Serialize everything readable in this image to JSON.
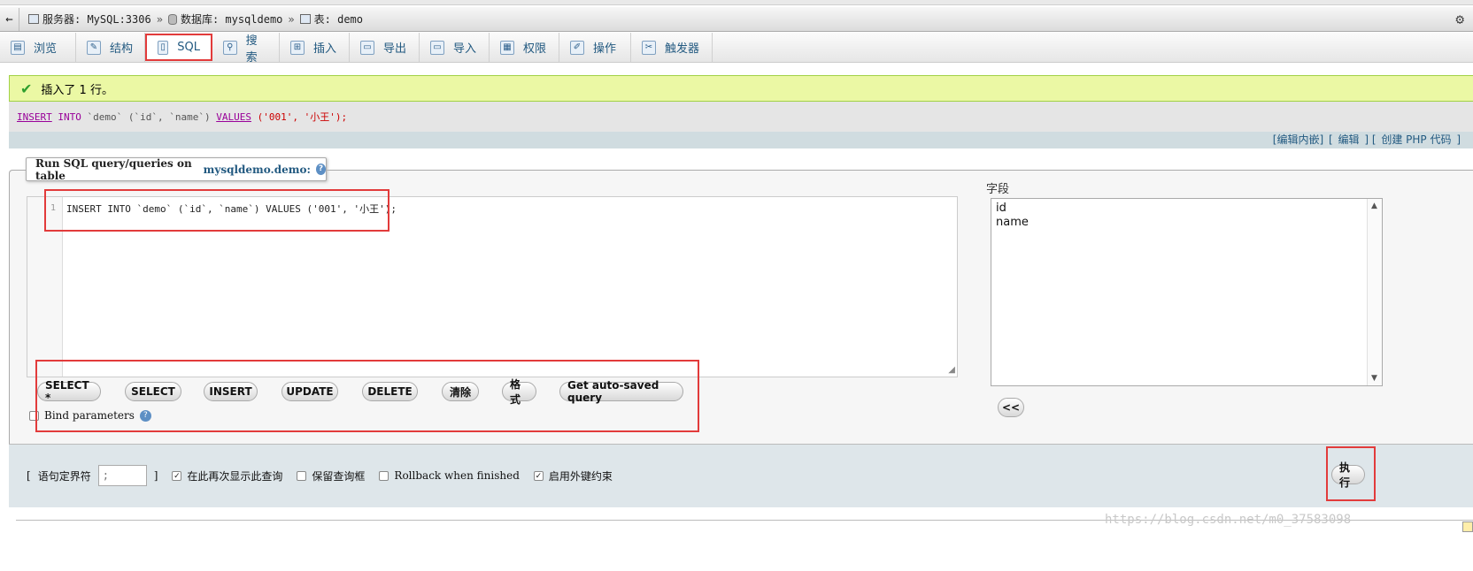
{
  "breadcrumb": {
    "back_icon": "←",
    "server": "服务器: MySQL:3306",
    "database": "数据库: mysqldemo",
    "table": "表: demo",
    "sep": "»"
  },
  "tabs": [
    {
      "label": "浏览",
      "icon": "browse-icon",
      "glyph": "▤"
    },
    {
      "label": "结构",
      "icon": "structure-icon",
      "glyph": "✎"
    },
    {
      "label": "SQL",
      "icon": "sql-icon",
      "glyph": "▯"
    },
    {
      "label": "搜索",
      "icon": "search-icon",
      "glyph": "⚲"
    },
    {
      "label": "插入",
      "icon": "insert-icon",
      "glyph": "⊞"
    },
    {
      "label": "导出",
      "icon": "export-icon",
      "glyph": "▭"
    },
    {
      "label": "导入",
      "icon": "import-icon",
      "glyph": "▭"
    },
    {
      "label": "权限",
      "icon": "privileges-icon",
      "glyph": "▦"
    },
    {
      "label": "操作",
      "icon": "operations-icon",
      "glyph": "✐"
    },
    {
      "label": "触发器",
      "icon": "triggers-icon",
      "glyph": "✂"
    }
  ],
  "message": {
    "success_text": "插入了 1 行。"
  },
  "sql_echo": {
    "insert": "INSERT",
    "into": "INTO",
    "table": "`demo`",
    "cols": "(`id`, `name`)",
    "values_kw": "VALUES",
    "values": "('001', '小王');"
  },
  "links": {
    "inline_edit": "[编辑内嵌]",
    "bracket": "[",
    "edit": "编辑",
    "bracket2": "] [",
    "php": "创建 PHP 代码",
    "bracket3": "]"
  },
  "query_box": {
    "legend_prefix": "Run SQL query/queries on table ",
    "legend_table": "mysqldemo.demo:",
    "line_number": "1",
    "code": "INSERT INTO `demo` (`id`, `name`) VALUES ('001', '小王');"
  },
  "fields": {
    "label": "字段",
    "items": [
      "id",
      "name"
    ],
    "add_button": "<<"
  },
  "buttons": [
    "SELECT *",
    "SELECT",
    "INSERT",
    "UPDATE",
    "DELETE",
    "清除",
    "格式",
    "Get auto-saved query"
  ],
  "bind_params": {
    "label": "Bind parameters"
  },
  "options": {
    "delimiter_label": "语句定界符",
    "delimiter_value": ";",
    "show_again": "在此再次显示此查询",
    "retain_box": "保留查询框",
    "rollback": "Rollback when finished",
    "foreign_keys": "启用外键约束",
    "go_button": "执行"
  },
  "watermark": "https://blog.csdn.net/m0_37583098",
  "colors": {
    "accent": "#235a81",
    "highlight_red": "#e23b3b",
    "success_bg": "#ebf8a4"
  }
}
